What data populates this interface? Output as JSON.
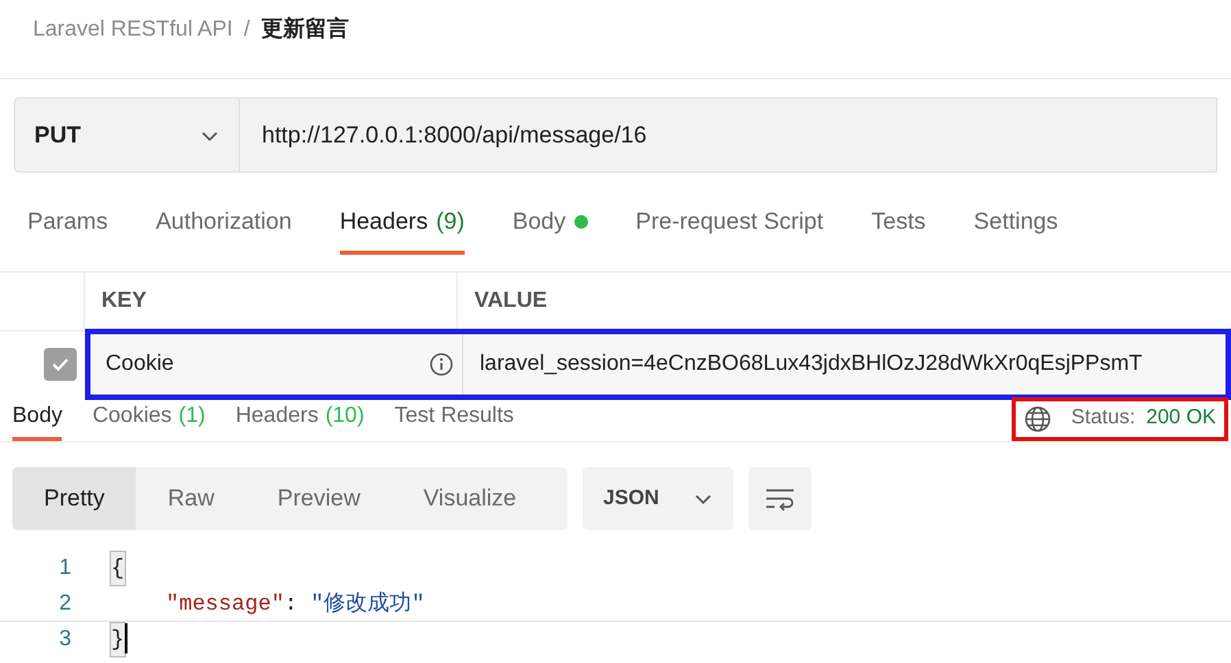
{
  "breadcrumb": {
    "parent": "Laravel RESTful API",
    "separator": "/",
    "current": "更新留言"
  },
  "request": {
    "method": "PUT",
    "url": "http://127.0.0.1:8000/api/message/16"
  },
  "request_tabs": [
    {
      "label": "Params",
      "selected": false
    },
    {
      "label": "Authorization",
      "selected": false
    },
    {
      "label": "Headers",
      "count": "(9)",
      "selected": true
    },
    {
      "label": "Body",
      "dot": true,
      "selected": false
    },
    {
      "label": "Pre-request Script",
      "selected": false
    },
    {
      "label": "Tests",
      "selected": false
    },
    {
      "label": "Settings",
      "selected": false
    }
  ],
  "headers_table": {
    "columns": [
      "KEY",
      "VALUE"
    ],
    "rows": [
      {
        "checked": true,
        "key": "Cookie",
        "value": "laravel_session=4eCnzBO68Lux43jdxBHlOzJ28dWkXr0qEsjPPsmT",
        "highlighted": true
      }
    ]
  },
  "response_tabs": [
    {
      "label": "Body",
      "selected": true
    },
    {
      "label": "Cookies",
      "count": "(1)",
      "selected": false
    },
    {
      "label": "Headers",
      "count": "(10)",
      "selected": false
    },
    {
      "label": "Test Results",
      "selected": false
    }
  ],
  "status": {
    "label": "Status:",
    "value": "200 OK",
    "highlighted": true
  },
  "view_modes": [
    {
      "label": "Pretty",
      "selected": true
    },
    {
      "label": "Raw",
      "selected": false
    },
    {
      "label": "Preview",
      "selected": false
    },
    {
      "label": "Visualize",
      "selected": false
    }
  ],
  "format": "JSON",
  "code": [
    {
      "number": "1",
      "tokens": [
        {
          "kind": "bracket",
          "text": "{",
          "matched": true
        }
      ]
    },
    {
      "number": "2",
      "indent": true,
      "tokens": [
        {
          "kind": "key",
          "text": "\"message\""
        },
        {
          "kind": "punct",
          "text": ": "
        },
        {
          "kind": "string",
          "text": "\"修改成功\""
        }
      ]
    },
    {
      "number": "3",
      "tokens": [
        {
          "kind": "bracket",
          "text": "}",
          "matched": true
        }
      ],
      "cursor": true
    }
  ]
}
